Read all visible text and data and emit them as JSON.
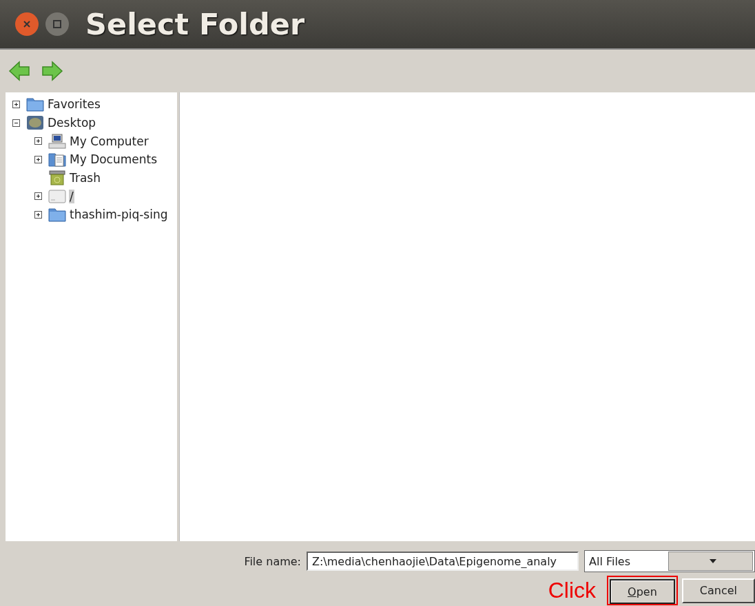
{
  "window": {
    "title": "Select Folder"
  },
  "tree": [
    {
      "label": "Favorites",
      "kind": "folder",
      "expanded": false,
      "selected": false
    },
    {
      "label": "Desktop",
      "kind": "desktop",
      "expanded": true,
      "selected": false,
      "children": [
        {
          "label": "My Computer",
          "kind": "computer",
          "expanded": false,
          "selected": false
        },
        {
          "label": "My Documents",
          "kind": "documents",
          "expanded": false,
          "selected": false
        },
        {
          "label": "Trash",
          "kind": "trash",
          "selected": false
        },
        {
          "label": "/",
          "kind": "drive",
          "expanded": false,
          "selected": true
        },
        {
          "label": "thashim-piq-sing",
          "kind": "folder",
          "expanded": false,
          "selected": false
        }
      ]
    }
  ],
  "file_name": {
    "label": "File name:",
    "value": "Z:\\media\\chenhaojie\\Data\\Epigenome_analy"
  },
  "file_type": {
    "value": "All Files"
  },
  "buttons": [
    {
      "label": "Open",
      "mnemonic": true,
      "highlighted": true
    },
    {
      "label": "Cancel",
      "mnemonic": false,
      "highlighted": false
    }
  ],
  "annotation": {
    "text": "Click"
  }
}
